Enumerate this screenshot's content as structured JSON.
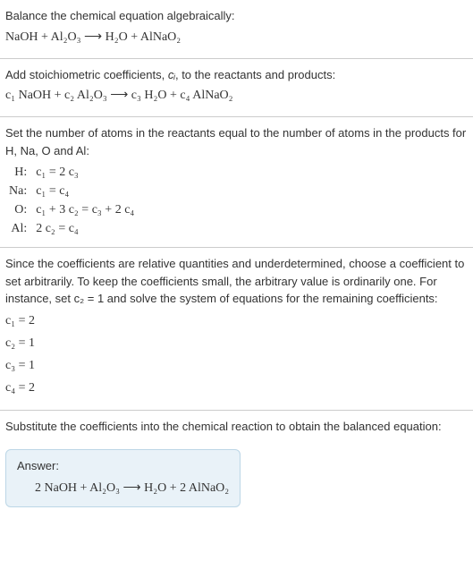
{
  "step1": {
    "text": "Balance the chemical equation algebraically:",
    "equation": "NaOH + Al₂O₃ ⟶ H₂O + AlNaO₂"
  },
  "step2": {
    "text_a": "Add stoichiometric coefficients, ",
    "text_ci": "cᵢ",
    "text_b": ", to the reactants and products:",
    "equation": "c₁ NaOH + c₂ Al₂O₃ ⟶ c₃ H₂O + c₄ AlNaO₂"
  },
  "step3": {
    "text": "Set the number of atoms in the reactants equal to the number of atoms in the products for H, Na, O and Al:",
    "rows": [
      {
        "el": "H:",
        "eq": "c₁ = 2 c₃"
      },
      {
        "el": "Na:",
        "eq": "c₁ = c₄"
      },
      {
        "el": "O:",
        "eq": "c₁ + 3 c₂ = c₃ + 2 c₄"
      },
      {
        "el": "Al:",
        "eq": "2 c₂ = c₄"
      }
    ]
  },
  "step4": {
    "text": "Since the coefficients are relative quantities and underdetermined, choose a coefficient to set arbitrarily. To keep the coefficients small, the arbitrary value is ordinarily one. For instance, set c₂ = 1 and solve the system of equations for the remaining coefficients:",
    "coeffs": [
      "c₁ = 2",
      "c₂ = 1",
      "c₃ = 1",
      "c₄ = 2"
    ]
  },
  "step5": {
    "text": "Substitute the coefficients into the chemical reaction to obtain the balanced equation:"
  },
  "answer": {
    "label": "Answer:",
    "equation": "2 NaOH + Al₂O₃ ⟶ H₂O + 2 AlNaO₂"
  }
}
